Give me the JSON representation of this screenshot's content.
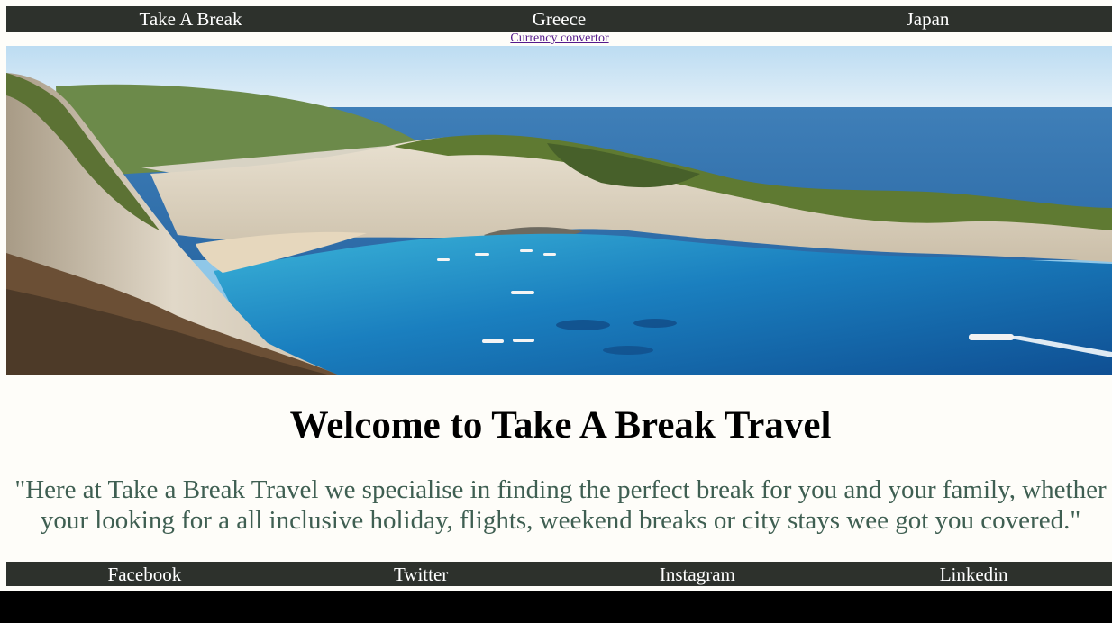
{
  "topnav": {
    "items": [
      "Take A Break",
      "Greece",
      "Japan"
    ]
  },
  "currency_link": "Currency convertor",
  "hero": {
    "alt": "Navagio beach cove with cliffs and turquoise sea"
  },
  "welcome": {
    "title": "Welcome to Take A Break Travel",
    "quote": "\"Here at Take a Break Travel we specialise in finding the perfect break for you and your family, whether your looking for a all inclusive holiday, flights, weekend breaks or city stays wee got you covered.\""
  },
  "footer": {
    "items": [
      "Facebook",
      "Twitter",
      "Instagram",
      "Linkedin"
    ]
  },
  "colors": {
    "nav_bg": "#2d312c",
    "page_bg": "#fefdf9",
    "quote_text": "#3f5f52",
    "link": "#551a8b"
  }
}
